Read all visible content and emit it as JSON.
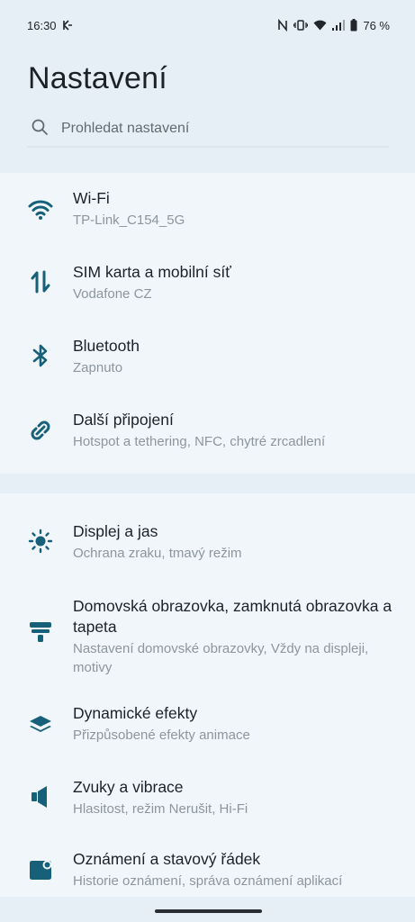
{
  "status_bar": {
    "time": "16:30",
    "battery": "76 %"
  },
  "header": {
    "title": "Nastavení",
    "search_placeholder": "Prohledat nastavení"
  },
  "groups": [
    {
      "items": [
        {
          "title": "Wi-Fi",
          "subtitle": "TP-Link_C154_5G",
          "icon": "wifi-icon"
        },
        {
          "title": "SIM karta a mobilní síť",
          "subtitle": "Vodafone CZ",
          "icon": "mobile-data-icon"
        },
        {
          "title": "Bluetooth",
          "subtitle": "Zapnuto",
          "icon": "bluetooth-icon"
        },
        {
          "title": "Další připojení",
          "subtitle": "Hotspot a tethering, NFC, chytré zrcadlení",
          "icon": "link-icon"
        }
      ]
    },
    {
      "items": [
        {
          "title": "Displej a jas",
          "subtitle": "Ochrana zraku, tmavý režim",
          "icon": "brightness-icon"
        },
        {
          "title": "Domovská obrazovka, zamknutá obrazovka a tapeta",
          "subtitle": "Nastavení domovské obrazovky, Vždy na displeji, motivy",
          "icon": "wallpaper-icon"
        },
        {
          "title": "Dynamické efekty",
          "subtitle": "Přizpůsobené efekty animace",
          "icon": "layers-icon"
        },
        {
          "title": "Zvuky a vibrace",
          "subtitle": "Hlasitost, režim Nerušit, Hi-Fi",
          "icon": "speaker-icon"
        },
        {
          "title": "Oznámení a stavový řádek",
          "subtitle": "Historie oznámení, správa oznámení aplikací",
          "icon": "notification-icon"
        }
      ]
    }
  ],
  "colors": {
    "accent": "#16607a",
    "background": "#e7eff6",
    "card": "#f1f6fa",
    "subtitle": "#8c969d"
  }
}
